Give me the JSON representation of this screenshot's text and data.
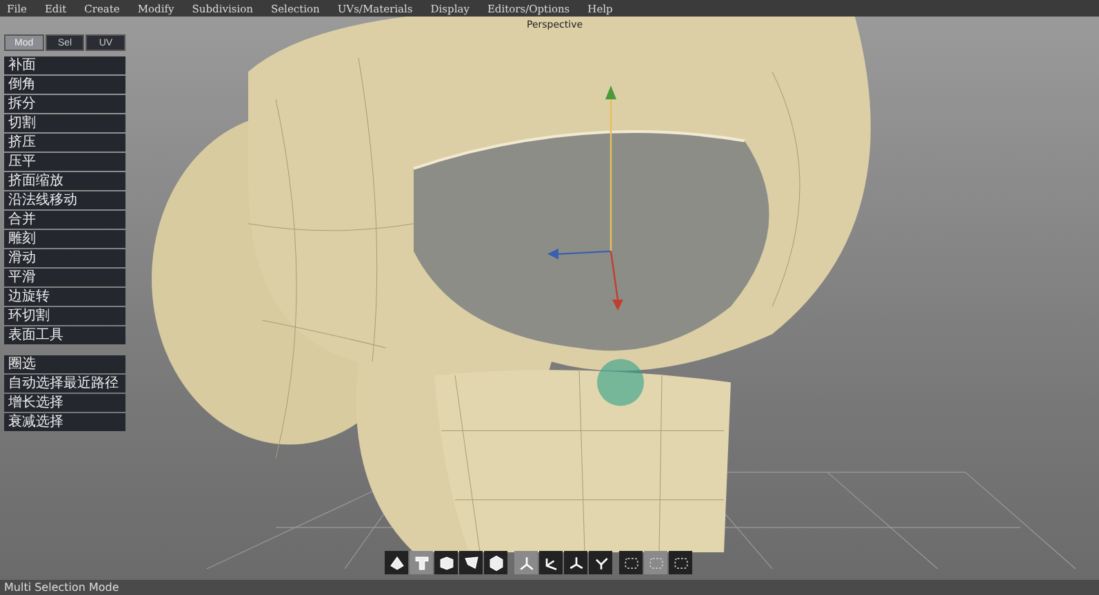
{
  "menu": [
    "File",
    "Edit",
    "Create",
    "Modify",
    "Subdivision",
    "Selection",
    "UVs/Materials",
    "Display",
    "Editors/Options",
    "Help"
  ],
  "viewport": {
    "label": "Perspective"
  },
  "panel": {
    "tabs": [
      {
        "label": "Mod",
        "selected": true
      },
      {
        "label": "Sel",
        "selected": false
      },
      {
        "label": "UV",
        "selected": false
      }
    ],
    "groups": [
      [
        "补面",
        "倒角",
        "拆分",
        "切割",
        "挤压",
        "压平",
        "挤面缩放",
        "沿法线移动",
        "合并",
        "雕刻",
        "滑动",
        "平滑",
        "边旋转",
        "环切割",
        "表面工具"
      ],
      [
        "圈选",
        "自动选择最近路径",
        "增长选择",
        "衰减选择"
      ]
    ]
  },
  "toolbar": [
    [
      {
        "selected": false
      },
      {
        "selected": true
      },
      {
        "selected": false
      },
      {
        "selected": false
      },
      {
        "selected": false
      }
    ],
    [
      {
        "selected": true
      },
      {
        "selected": false
      },
      {
        "selected": false
      },
      {
        "selected": false
      }
    ],
    [
      {
        "selected": false
      },
      {
        "selected": true
      },
      {
        "selected": false
      }
    ]
  ],
  "status_bar": "Multi Selection Mode"
}
